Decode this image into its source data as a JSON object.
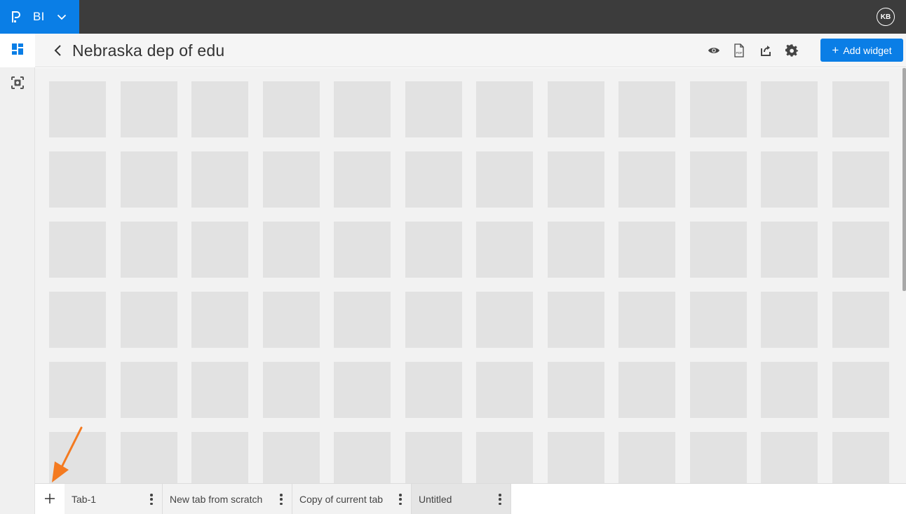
{
  "topbar": {
    "app_name": "BI",
    "user_initials": "KB",
    "brand_color": "#0a7ee6",
    "bar_color": "#3c3c3c"
  },
  "leftrail": {
    "items": [
      {
        "icon": "dashboard-icon",
        "active": true
      },
      {
        "icon": "scan-icon",
        "active": false
      }
    ]
  },
  "header": {
    "title": "Nebraska dep of edu",
    "icons": [
      "eye-icon",
      "pdf-icon",
      "share-icon",
      "settings-icon"
    ],
    "add_widget_label": "Add widget"
  },
  "canvas": {
    "placeholder_columns": 12,
    "placeholder_rows": 6
  },
  "tabbar": {
    "tabs": [
      {
        "label": "Tab-1",
        "active": false
      },
      {
        "label": "New tab from scratch",
        "active": false
      },
      {
        "label": "Copy of current tab",
        "active": false
      },
      {
        "label": "Untitled",
        "active": true
      }
    ]
  },
  "annotation": {
    "arrow_color": "#f47a20",
    "points_to": "add-tab-button"
  }
}
